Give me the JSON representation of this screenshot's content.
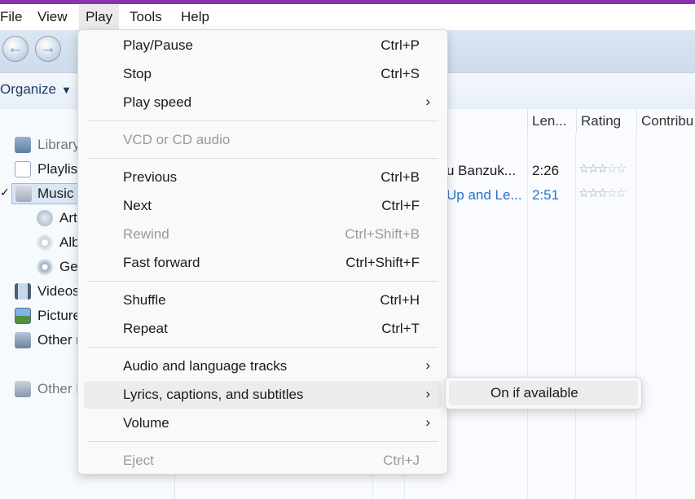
{
  "menubar": {
    "items": [
      "File",
      "View",
      "Play",
      "Tools",
      "Help"
    ]
  },
  "toolbar": {
    "organize_label": "Organize"
  },
  "sidebar": {
    "items": [
      "Library",
      "Playlists",
      "Music",
      "Artist",
      "Album",
      "Genre",
      "Videos",
      "Pictures",
      "Other media",
      "Other Libraries"
    ]
  },
  "columns": {
    "length": "Len...",
    "rating": "Rating",
    "contributing": "Contribu"
  },
  "rows": [
    {
      "title": "u Banzuk...",
      "length": "2:26",
      "rating_stars": 3
    },
    {
      "title": "Up and Le...",
      "length": "2:51",
      "rating_stars": 3
    }
  ],
  "play_menu": {
    "play_pause": {
      "label": "Play/Pause",
      "shortcut": "Ctrl+P"
    },
    "stop": {
      "label": "Stop",
      "shortcut": "Ctrl+S"
    },
    "play_speed": {
      "label": "Play speed"
    },
    "vcd": {
      "label": "VCD or CD audio"
    },
    "previous": {
      "label": "Previous",
      "shortcut": "Ctrl+B"
    },
    "next": {
      "label": "Next",
      "shortcut": "Ctrl+F"
    },
    "rewind": {
      "label": "Rewind",
      "shortcut": "Ctrl+Shift+B"
    },
    "fast_forward": {
      "label": "Fast forward",
      "shortcut": "Ctrl+Shift+F"
    },
    "shuffle": {
      "label": "Shuffle",
      "shortcut": "Ctrl+H"
    },
    "repeat": {
      "label": "Repeat",
      "shortcut": "Ctrl+T"
    },
    "audio_tracks": {
      "label": "Audio and language tracks"
    },
    "lyrics": {
      "label": "Lyrics, captions, and subtitles"
    },
    "volume": {
      "label": "Volume"
    },
    "eject": {
      "label": "Eject",
      "shortcut": "Ctrl+J"
    }
  },
  "submenu": {
    "on_if_available": "On if available"
  },
  "icons": {
    "arrow": "chevron-right-icon"
  },
  "colors": {
    "title_accent": "#8b2fb3",
    "link_blue": "#2a6fc9"
  }
}
